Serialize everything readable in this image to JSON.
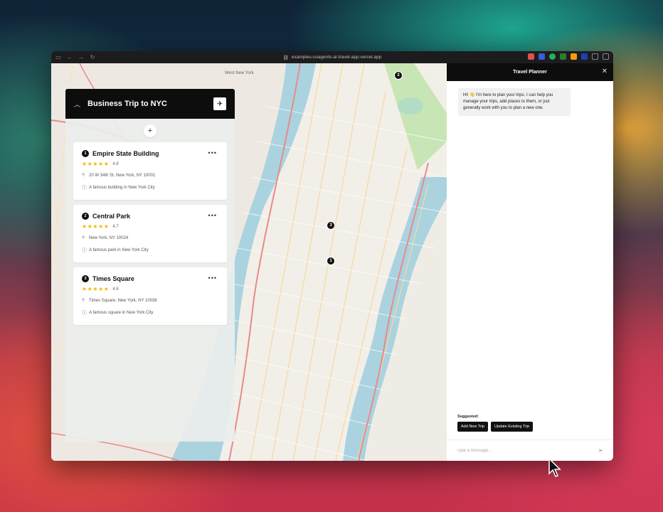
{
  "browser": {
    "url": "examples-coagents-ai-travel-app.vercel.app"
  },
  "map": {
    "labels": [
      "West New York"
    ],
    "pins": [
      {
        "label": "2"
      },
      {
        "label": "3"
      },
      {
        "label": "1"
      }
    ]
  },
  "trip": {
    "title": "Business Trip to NYC",
    "add_label": "+",
    "places": [
      {
        "number": "1",
        "name": "Empire State Building",
        "rating": "4.8",
        "stars": "★★★★★",
        "address": "20 W 34th St, New York, NY 10001",
        "description": "A famous building in New York City"
      },
      {
        "number": "2",
        "name": "Central Park",
        "rating": "4.7",
        "stars": "★★★★★",
        "address": "New York, NY 10024",
        "description": "A famous park in New York City"
      },
      {
        "number": "3",
        "name": "Times Square",
        "rating": "4.6",
        "stars": "★★★★★",
        "address": "Times Square, New York, NY 10036",
        "description": "A famous square in New York City"
      }
    ]
  },
  "chat": {
    "title": "Travel Planner",
    "greeting": "Hi! 👋 I'm here to plan your trips. I can help you manage your trips, add places to them, or just generally work with you to plan a new one.",
    "suggested_label": "Suggested:",
    "suggestions": [
      "Add New Trip",
      "Update Existing Trip"
    ],
    "input_placeholder": "Type a message..."
  }
}
